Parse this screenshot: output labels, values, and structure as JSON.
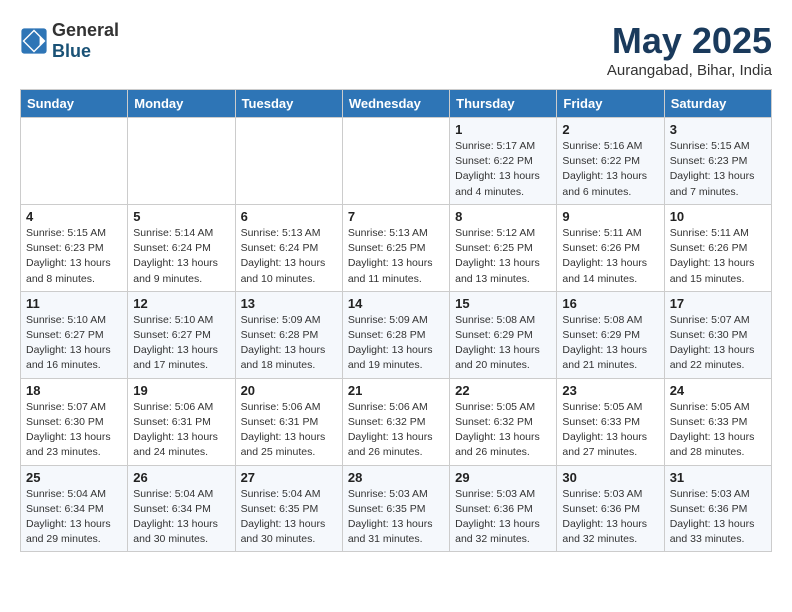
{
  "logo": {
    "general": "General",
    "blue": "Blue"
  },
  "header": {
    "month": "May 2025",
    "location": "Aurangabad, Bihar, India"
  },
  "days_of_week": [
    "Sunday",
    "Monday",
    "Tuesday",
    "Wednesday",
    "Thursday",
    "Friday",
    "Saturday"
  ],
  "weeks": [
    [
      {
        "day": "",
        "info": ""
      },
      {
        "day": "",
        "info": ""
      },
      {
        "day": "",
        "info": ""
      },
      {
        "day": "",
        "info": ""
      },
      {
        "day": "1",
        "info": "Sunrise: 5:17 AM\nSunset: 6:22 PM\nDaylight: 13 hours\nand 4 minutes."
      },
      {
        "day": "2",
        "info": "Sunrise: 5:16 AM\nSunset: 6:22 PM\nDaylight: 13 hours\nand 6 minutes."
      },
      {
        "day": "3",
        "info": "Sunrise: 5:15 AM\nSunset: 6:23 PM\nDaylight: 13 hours\nand 7 minutes."
      }
    ],
    [
      {
        "day": "4",
        "info": "Sunrise: 5:15 AM\nSunset: 6:23 PM\nDaylight: 13 hours\nand 8 minutes."
      },
      {
        "day": "5",
        "info": "Sunrise: 5:14 AM\nSunset: 6:24 PM\nDaylight: 13 hours\nand 9 minutes."
      },
      {
        "day": "6",
        "info": "Sunrise: 5:13 AM\nSunset: 6:24 PM\nDaylight: 13 hours\nand 10 minutes."
      },
      {
        "day": "7",
        "info": "Sunrise: 5:13 AM\nSunset: 6:25 PM\nDaylight: 13 hours\nand 11 minutes."
      },
      {
        "day": "8",
        "info": "Sunrise: 5:12 AM\nSunset: 6:25 PM\nDaylight: 13 hours\nand 13 minutes."
      },
      {
        "day": "9",
        "info": "Sunrise: 5:11 AM\nSunset: 6:26 PM\nDaylight: 13 hours\nand 14 minutes."
      },
      {
        "day": "10",
        "info": "Sunrise: 5:11 AM\nSunset: 6:26 PM\nDaylight: 13 hours\nand 15 minutes."
      }
    ],
    [
      {
        "day": "11",
        "info": "Sunrise: 5:10 AM\nSunset: 6:27 PM\nDaylight: 13 hours\nand 16 minutes."
      },
      {
        "day": "12",
        "info": "Sunrise: 5:10 AM\nSunset: 6:27 PM\nDaylight: 13 hours\nand 17 minutes."
      },
      {
        "day": "13",
        "info": "Sunrise: 5:09 AM\nSunset: 6:28 PM\nDaylight: 13 hours\nand 18 minutes."
      },
      {
        "day": "14",
        "info": "Sunrise: 5:09 AM\nSunset: 6:28 PM\nDaylight: 13 hours\nand 19 minutes."
      },
      {
        "day": "15",
        "info": "Sunrise: 5:08 AM\nSunset: 6:29 PM\nDaylight: 13 hours\nand 20 minutes."
      },
      {
        "day": "16",
        "info": "Sunrise: 5:08 AM\nSunset: 6:29 PM\nDaylight: 13 hours\nand 21 minutes."
      },
      {
        "day": "17",
        "info": "Sunrise: 5:07 AM\nSunset: 6:30 PM\nDaylight: 13 hours\nand 22 minutes."
      }
    ],
    [
      {
        "day": "18",
        "info": "Sunrise: 5:07 AM\nSunset: 6:30 PM\nDaylight: 13 hours\nand 23 minutes."
      },
      {
        "day": "19",
        "info": "Sunrise: 5:06 AM\nSunset: 6:31 PM\nDaylight: 13 hours\nand 24 minutes."
      },
      {
        "day": "20",
        "info": "Sunrise: 5:06 AM\nSunset: 6:31 PM\nDaylight: 13 hours\nand 25 minutes."
      },
      {
        "day": "21",
        "info": "Sunrise: 5:06 AM\nSunset: 6:32 PM\nDaylight: 13 hours\nand 26 minutes."
      },
      {
        "day": "22",
        "info": "Sunrise: 5:05 AM\nSunset: 6:32 PM\nDaylight: 13 hours\nand 26 minutes."
      },
      {
        "day": "23",
        "info": "Sunrise: 5:05 AM\nSunset: 6:33 PM\nDaylight: 13 hours\nand 27 minutes."
      },
      {
        "day": "24",
        "info": "Sunrise: 5:05 AM\nSunset: 6:33 PM\nDaylight: 13 hours\nand 28 minutes."
      }
    ],
    [
      {
        "day": "25",
        "info": "Sunrise: 5:04 AM\nSunset: 6:34 PM\nDaylight: 13 hours\nand 29 minutes."
      },
      {
        "day": "26",
        "info": "Sunrise: 5:04 AM\nSunset: 6:34 PM\nDaylight: 13 hours\nand 30 minutes."
      },
      {
        "day": "27",
        "info": "Sunrise: 5:04 AM\nSunset: 6:35 PM\nDaylight: 13 hours\nand 30 minutes."
      },
      {
        "day": "28",
        "info": "Sunrise: 5:03 AM\nSunset: 6:35 PM\nDaylight: 13 hours\nand 31 minutes."
      },
      {
        "day": "29",
        "info": "Sunrise: 5:03 AM\nSunset: 6:36 PM\nDaylight: 13 hours\nand 32 minutes."
      },
      {
        "day": "30",
        "info": "Sunrise: 5:03 AM\nSunset: 6:36 PM\nDaylight: 13 hours\nand 32 minutes."
      },
      {
        "day": "31",
        "info": "Sunrise: 5:03 AM\nSunset: 6:36 PM\nDaylight: 13 hours\nand 33 minutes."
      }
    ]
  ]
}
